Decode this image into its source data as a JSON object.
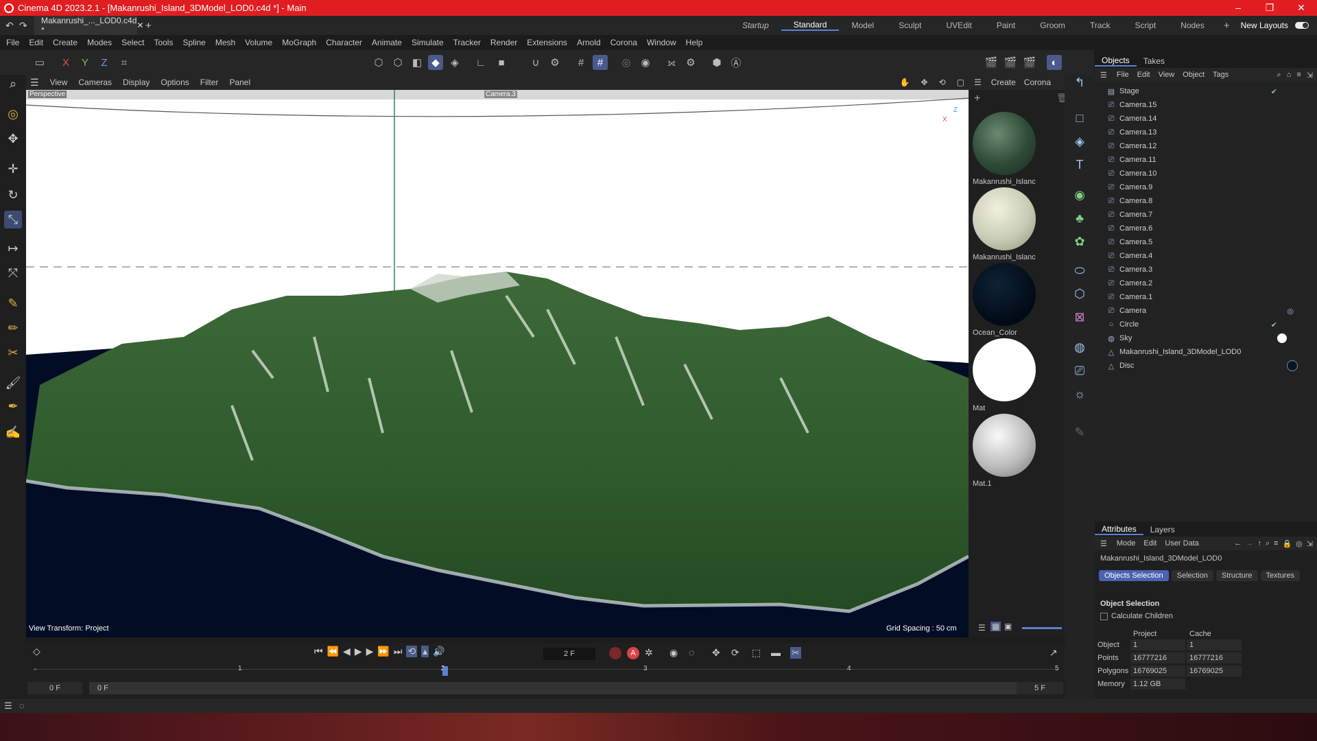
{
  "window": {
    "title": "Cinema 4D 2023.2.1 - [Makanrushi_Island_3DModel_LOD0.c4d *] - Main",
    "controls": [
      "–",
      "❐",
      "✕"
    ]
  },
  "document_tab": {
    "label": "Makanrushi_..._LOD0.c4d *",
    "close": "✕",
    "add": "+"
  },
  "layouts": [
    "Startup",
    "Standard",
    "Model",
    "Sculpt",
    "UVEdit",
    "Paint",
    "Groom",
    "Track",
    "Script",
    "Nodes"
  ],
  "layouts_active": "Standard",
  "layouts_add": "+",
  "new_layouts": "New Layouts",
  "menu": [
    "File",
    "Edit",
    "Create",
    "Modes",
    "Select",
    "Tools",
    "Spline",
    "Mesh",
    "Volume",
    "MoGraph",
    "Character",
    "Animate",
    "Simulate",
    "Tracker",
    "Render",
    "Extensions",
    "Arnold",
    "Corona",
    "Window",
    "Help"
  ],
  "axis_buttons": {
    "x": "X",
    "y": "Y",
    "z": "Z"
  },
  "viewport": {
    "menu": [
      "View",
      "Cameras",
      "Display",
      "Options",
      "Filter",
      "Panel"
    ],
    "label": "Perspective",
    "camera_label": "Camera.3",
    "view_transform": "View Transform: Project",
    "grid_spacing": "Grid Spacing : 50 cm",
    "axis_x": "X",
    "axis_z": "Z"
  },
  "materials": {
    "menu": [
      "Create",
      "Corona"
    ],
    "items": [
      "Makanrushi_Islanc",
      "Makanrushi_Islanc",
      "Ocean_Color",
      "Mat",
      "Mat.1"
    ]
  },
  "objects": {
    "tabs": [
      "Objects",
      "Takes"
    ],
    "menu": [
      "File",
      "Edit",
      "View",
      "Object",
      "Tags"
    ],
    "rows": [
      "Stage",
      "Camera.15",
      "Camera.14",
      "Camera.13",
      "Camera.12",
      "Camera.11",
      "Camera.10",
      "Camera.9",
      "Camera.8",
      "Camera.7",
      "Camera.6",
      "Camera.5",
      "Camera.4",
      "Camera.3",
      "Camera.2",
      "Camera.1",
      "Camera",
      "Circle",
      "Sky",
      "Makanrushi_Island_3DModel_LOD0",
      "Disc"
    ]
  },
  "attributes": {
    "tabs": [
      "Attributes",
      "Layers"
    ],
    "menu": [
      "Mode",
      "Edit",
      "User Data"
    ],
    "object_name": "Makanrushi_Island_3DModel_LOD0",
    "subtabs": [
      "Objects Selection",
      "Selection",
      "Structure",
      "Textures"
    ],
    "section": "Object Selection",
    "calculate_children": "Calculate Children",
    "col_project": "Project",
    "col_cache": "Cache",
    "rows": [
      {
        "label": "Object",
        "project": "1",
        "cache": "1"
      },
      {
        "label": "Points",
        "project": "16777216",
        "cache": "16777216"
      },
      {
        "label": "Polygons",
        "project": "16769025",
        "cache": "16769025"
      },
      {
        "label": "Memory",
        "project": "1.12 GB",
        "cache": ""
      }
    ]
  },
  "timeline": {
    "current_frame": "2 F",
    "ruler": [
      "1",
      "2",
      "3",
      "4",
      "5"
    ],
    "start": "0 F",
    "start2": "0 F",
    "end": "5 F",
    "end2": "5 F",
    "record_label": "A"
  },
  "colors": {
    "titlebar": "#e01e22",
    "accent": "#5c80d6",
    "selected_tool": "#4a5a8a"
  }
}
